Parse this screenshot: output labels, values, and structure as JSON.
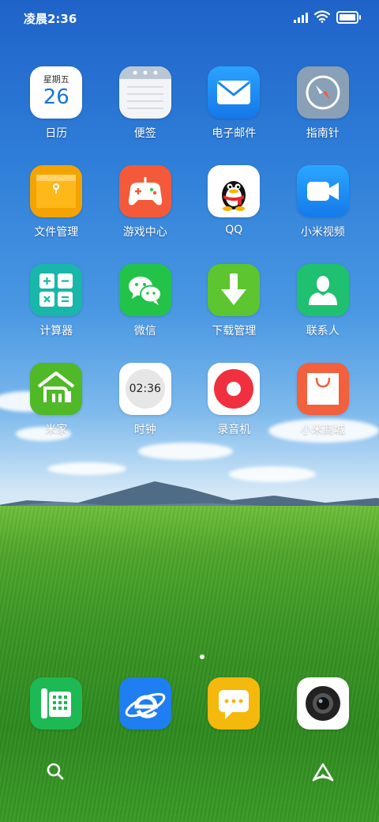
{
  "status_bar": {
    "time": "凌晨2:36"
  },
  "apps": [
    {
      "label": "日历",
      "icon": "calendar-icon",
      "weekday": "星期五",
      "day": "26",
      "color": "#ffffff"
    },
    {
      "label": "便签",
      "icon": "notes-icon",
      "color": "#f2f4f7"
    },
    {
      "label": "电子邮件",
      "icon": "mail-icon",
      "color": "#1e90f5"
    },
    {
      "label": "指南针",
      "icon": "compass-icon",
      "color": "#8aa0b6"
    },
    {
      "label": "文件管理",
      "icon": "folder-icon",
      "color": "#f5a300"
    },
    {
      "label": "游戏中心",
      "icon": "gamepad-icon",
      "color": "#f4593a"
    },
    {
      "label": "QQ",
      "icon": "qq-penguin-icon",
      "color": "#ffffff"
    },
    {
      "label": "小米视频",
      "icon": "video-camera-icon",
      "color": "#1a8cf5"
    },
    {
      "label": "计算器",
      "icon": "calculator-icon",
      "color": "#19b7a9"
    },
    {
      "label": "微信",
      "icon": "wechat-icon",
      "color": "#23c34a"
    },
    {
      "label": "下载管理",
      "icon": "download-arrow-icon",
      "color": "#5cc52f"
    },
    {
      "label": "联系人",
      "icon": "contact-person-icon",
      "color": "#1fc070"
    },
    {
      "label": "米家",
      "icon": "mijia-home-icon",
      "color": "#4fb928"
    },
    {
      "label": "时钟",
      "icon": "clock-icon",
      "clock_time": "02:36",
      "color": "#ffffff"
    },
    {
      "label": "录音机",
      "icon": "recorder-icon",
      "color": "#ffffff"
    },
    {
      "label": "小米商城",
      "icon": "shopping-bag-icon",
      "color": "#f2603d"
    }
  ],
  "dock": [
    {
      "icon": "phone-icon",
      "color": "#1db954"
    },
    {
      "icon": "browser-icon",
      "color": "#1f7ef2"
    },
    {
      "icon": "messages-icon",
      "color": "#f5b80d"
    },
    {
      "icon": "camera-icon",
      "color": "#ffffff"
    }
  ],
  "bottom": {
    "left_icon": "search-icon",
    "right_icon": "assistant-icon"
  }
}
